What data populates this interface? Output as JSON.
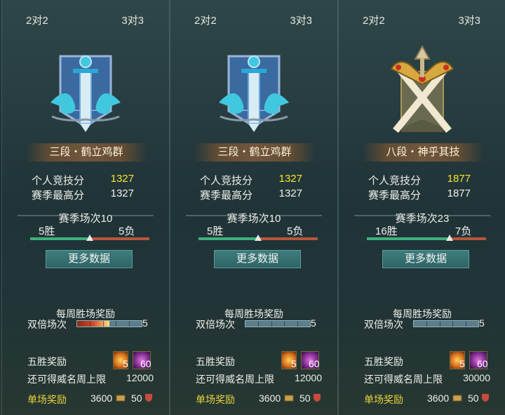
{
  "panels": [
    {
      "tabs": [
        "2对2",
        "3对3"
      ],
      "rank_name": "三段・鹤立鸡群",
      "emblem": "blue-sword-banner-emblem",
      "personal_score_label": "个人竞技分",
      "personal_score": "1327",
      "season_high_label": "赛季最高分",
      "season_high": "1327",
      "season_matches": "赛季场次10",
      "wins": "5胜",
      "losses": "5负",
      "win_ratio": 0.5,
      "more_data": "更多数据",
      "weekly_reward": "每周胜场奖励",
      "double_label": "双倍场次",
      "double_count": "5",
      "double_progress": 0.5,
      "five_win_reward": "五胜奖励",
      "item1_count": "5",
      "item2_count": "60",
      "fame_limit_label": "还可得威名周上限",
      "fame_limit": "12000",
      "single_reward_label": "单场奖励",
      "single_reward_a": "3600",
      "single_reward_b": "50"
    },
    {
      "tabs": [
        "2对2",
        "3对3"
      ],
      "rank_name": "三段・鹤立鸡群",
      "emblem": "blue-sword-banner-emblem",
      "personal_score_label": "个人竞技分",
      "personal_score": "1327",
      "season_high_label": "赛季最高分",
      "season_high": "1327",
      "season_matches": "赛季场次10",
      "wins": "5胜",
      "losses": "5负",
      "win_ratio": 0.5,
      "more_data": "更多数据",
      "weekly_reward": "每周胜场奖励",
      "double_label": "双倍场次",
      "double_count": "5",
      "double_progress": 0,
      "five_win_reward": "五胜奖励",
      "item1_count": "5",
      "item2_count": "60",
      "fame_limit_label": "还可得威名周上限",
      "fame_limit": "12000",
      "single_reward_label": "单场奖励",
      "single_reward_a": "3600",
      "single_reward_b": "50"
    },
    {
      "tabs": [
        "2对2",
        "3对3"
      ],
      "rank_name": "八段・神乎其技",
      "emblem": "golden-crossed-swords-emblem",
      "personal_score_label": "个人竞技分",
      "personal_score": "1877",
      "season_high_label": "赛季最高分",
      "season_high": "1877",
      "season_matches": "赛季场次23",
      "wins": "16胜",
      "losses": "7负",
      "win_ratio": 0.696,
      "more_data": "更多数据",
      "weekly_reward": "每周胜场奖励",
      "double_label": "双倍场次",
      "double_count": "5",
      "double_progress": 0,
      "five_win_reward": "五胜奖励",
      "item1_count": "5",
      "item2_count": "60",
      "fame_limit_label": "还可得威名周上限",
      "fame_limit": "30000",
      "single_reward_label": "单场奖励",
      "single_reward_a": "3600",
      "single_reward_b": "50"
    }
  ]
}
